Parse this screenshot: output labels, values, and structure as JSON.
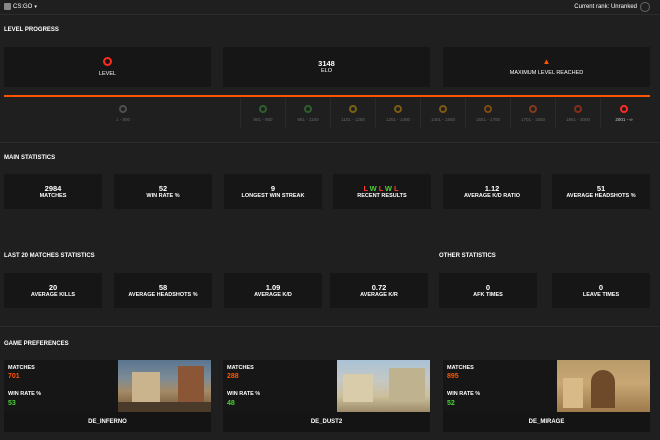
{
  "header": {
    "game": "CS:GO",
    "caret": "▾",
    "rank_label": "Current rank: Unranked"
  },
  "level_progress": {
    "title": "LEVEL PROGRESS",
    "level_label": "LEVEL",
    "elo_value": "3148",
    "elo_label": "ELO",
    "max_label": "MAXIMUM LEVEL REACHED",
    "ranges": [
      "1 - 800",
      "801 - 950",
      "951 - 1100",
      "1101 - 1250",
      "1251 - 1400",
      "1401 - 1550",
      "1551 - 1700",
      "1701 - 1850",
      "1851 - 2000",
      "2001 - ∞"
    ],
    "colors": [
      "#8a8a8a",
      "#3fae3f",
      "#3fae3f",
      "#e6b400",
      "#f0a000",
      "#f0a000",
      "#f08000",
      "#ff5a1f",
      "#ff3d1f",
      "#ff2b1f"
    ]
  },
  "main_stats": {
    "title": "MAIN STATISTICS",
    "matches": {
      "value": "2984",
      "label": "MATCHES"
    },
    "win_rate": {
      "value": "52",
      "label": "WIN RATE %"
    },
    "longest_streak": {
      "value": "9",
      "label": "LONGEST WIN STREAK"
    },
    "recent": {
      "results": [
        {
          "r": "L",
          "color": "#ff3b30"
        },
        {
          "r": "W",
          "color": "#4cd137"
        },
        {
          "r": "L",
          "color": "#ff3b30"
        },
        {
          "r": "W",
          "color": "#4cd137"
        },
        {
          "r": "L",
          "color": "#ff3b30"
        }
      ],
      "label": "RECENT RESULTS"
    },
    "kd": {
      "value": "1.12",
      "label": "AVERAGE K/D RATIO"
    },
    "hs": {
      "value": "51",
      "label": "AVERAGE HEADSHOTS %"
    }
  },
  "last20": {
    "title": "LAST 20 MATCHES STATISTICS",
    "kills": {
      "value": "20",
      "label": "AVERAGE KILLS"
    },
    "hs": {
      "value": "58",
      "label": "AVERAGE HEADSHOTS %"
    },
    "kd": {
      "value": "1.09",
      "label": "AVERAGE K/D"
    },
    "kr": {
      "value": "0.72",
      "label": "AVERAGE K/R"
    }
  },
  "other": {
    "title": "OTHER STATISTICS",
    "afk": {
      "value": "0",
      "label": "AFK TIMES"
    },
    "leave": {
      "value": "0",
      "label": "LEAVE TIMES"
    }
  },
  "game_prefs": {
    "title": "GAME PREFERENCES",
    "maps": [
      {
        "matches_label": "MATCHES",
        "matches": "701",
        "win_label": "WIN RATE %",
        "win": "53",
        "map": "DE_INFERNO"
      },
      {
        "matches_label": "MATCHES",
        "matches": "288",
        "win_label": "WIN RATE %",
        "win": "48",
        "map": "DE_DUST2"
      },
      {
        "matches_label": "MATCHES",
        "matches": "895",
        "win_label": "WIN RATE %",
        "win": "52",
        "map": "DE_MIRAGE"
      }
    ]
  },
  "colors": {
    "accent": "#ff5500",
    "green": "#4cd137",
    "card": "#161616",
    "bg": "#1f1f1f"
  }
}
